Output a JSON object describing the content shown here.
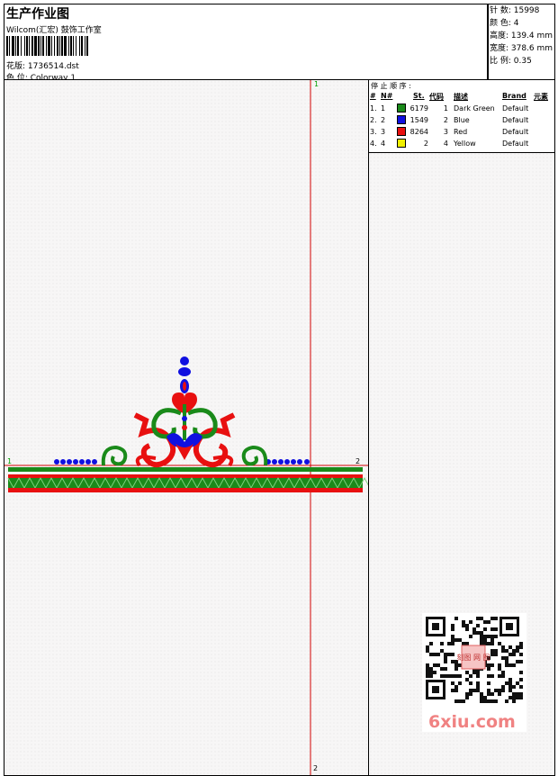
{
  "header": {
    "title": "生产作业图",
    "studio": "Wilcom(汇宏) 鼓饰工作室",
    "file_label": "花版: 1736514.dst",
    "colorway_label": "色 位:  Colorway 1"
  },
  "stats": {
    "stitches": "针 数:  15998",
    "colors": "颜 色:  4",
    "height": "高度: 139.4 mm",
    "width": "宽度: 378.6 mm",
    "scale": "比 例:  0.35"
  },
  "stop_sequence": {
    "title": "停 止 顺 序 :",
    "headers": {
      "num": "#",
      "n": "N#",
      "st": "St.",
      "code": "代码",
      "desc": "描述",
      "brand": "Brand",
      "elem": "元素"
    },
    "rows": [
      {
        "num": "1.",
        "n": "1",
        "color": "#1a8a1a",
        "st": "6179",
        "code": "1",
        "desc": "Dark Green",
        "brand": "Default"
      },
      {
        "num": "2.",
        "n": "2",
        "color": "#1010e0",
        "st": "1549",
        "code": "2",
        "desc": "Blue",
        "brand": "Default"
      },
      {
        "num": "3.",
        "n": "3",
        "color": "#e81010",
        "st": "8264",
        "code": "3",
        "desc": "Red",
        "brand": "Default"
      },
      {
        "num": "4.",
        "n": "4",
        "color": "#f0f000",
        "st": "2",
        "code": "4",
        "desc": "Yellow",
        "brand": "Default"
      }
    ]
  },
  "markers": {
    "top": "1",
    "bottom": "2",
    "left": "1",
    "right": "2"
  },
  "watermark": {
    "stamp": "刻图 网 图",
    "logo": "6xiu.com"
  },
  "colors": {
    "guide": "#d00000",
    "marker": "#00a000"
  }
}
